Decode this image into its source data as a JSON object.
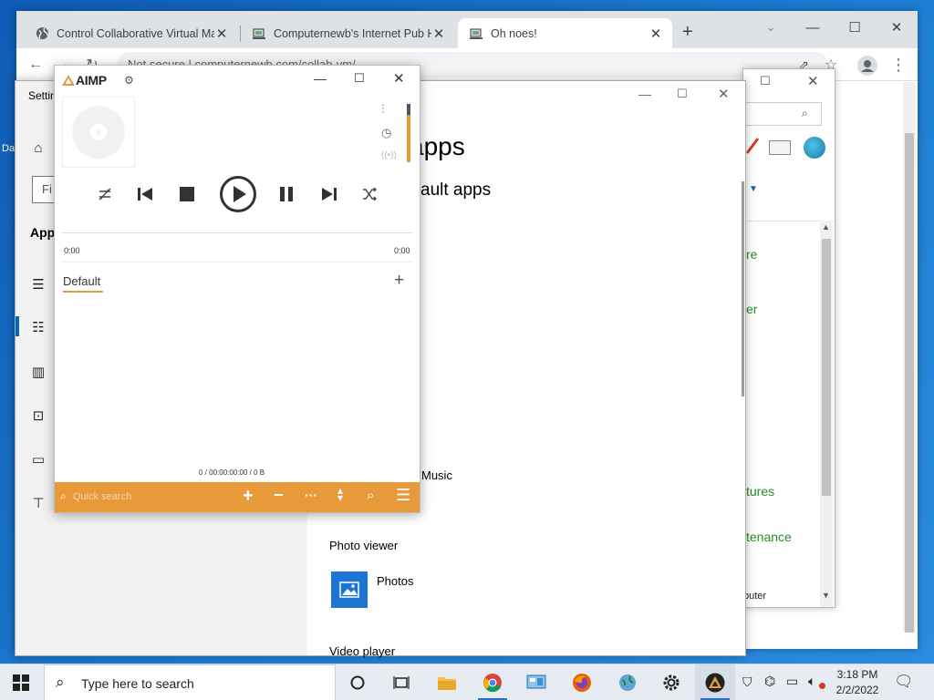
{
  "browser": {
    "tabs": [
      {
        "title": "Control Collaborative Virtual Ma"
      },
      {
        "title": "Computernewb's Internet Pub H"
      },
      {
        "title": "Oh noes!"
      }
    ],
    "address": "Not secure  |  computernewb.com/collab-vm/"
  },
  "control_panel": {
    "links": [
      "re",
      "er",
      "tures",
      "tenance",
      "puter"
    ]
  },
  "settings": {
    "window_title": "Settin",
    "search_placeholder": "Fi",
    "section_label": "App",
    "page_title": "apps",
    "subtitle": "ault apps",
    "music_label": "Music",
    "photo_viewer_label": "Photo viewer",
    "photos_app": "Photos",
    "video_player_label": "Video player"
  },
  "aimp": {
    "logo": "AIMP",
    "time_start": "0:00",
    "time_end": "0:00",
    "playlist_tab": "Default",
    "status": "0 / 00:00:00:00 / 0 B",
    "quick_search_placeholder": "Quick search"
  },
  "taskbar": {
    "search_placeholder": "Type here to search",
    "time": "3:18 PM",
    "date": "2/2/2022"
  },
  "desktop": {
    "icon_label": "Da"
  },
  "colors": {
    "aimp_accent": "#e8993a",
    "chrome_tabbar": "#dee1e6",
    "photos_tile": "#1e74d2",
    "desktop": "#1a73c8"
  }
}
